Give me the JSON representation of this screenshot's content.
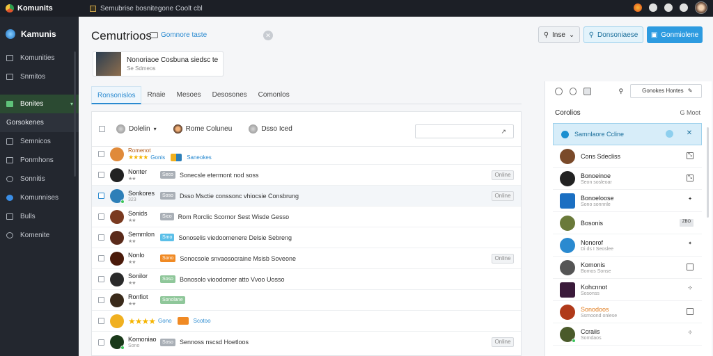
{
  "app": {
    "brand": "Komunits",
    "window_title": "Semubrise bosnitegone Coolt cbl"
  },
  "sidebar": {
    "header": "Kamunis",
    "items": [
      {
        "label": "Komunities"
      },
      {
        "label": "Snmitos"
      },
      {
        "label": "Bonites",
        "active": true
      },
      {
        "label": "Gorsokenes",
        "sub": true
      },
      {
        "label": "Semnicos"
      },
      {
        "label": "Ponmhons"
      },
      {
        "label": "Sonnitis"
      },
      {
        "label": "Komunnises"
      },
      {
        "label": "Bulls"
      },
      {
        "label": "Komenite"
      }
    ]
  },
  "header": {
    "page_title": "Cemutrioos",
    "title_link": "Gomnore taste",
    "filter_button": "Inse",
    "secondary_button": "Donsoniaese",
    "primary_button": "Gonmiolene"
  },
  "profile_card": {
    "title": "Nonoriaoe Cosbuna siedsc te",
    "subtitle": "Se Sdmeos"
  },
  "tabs": [
    "Ronsonislos",
    "Rnaie",
    "Mesoes",
    "Desosones",
    "Comonlos"
  ],
  "table": {
    "header": {
      "col1": "Dolelin",
      "col2": "Rome Coluneu",
      "col3": "Dsso Iced"
    },
    "rows": [
      {
        "name": "Romenot",
        "stars": "★★★★",
        "link": "Gonis",
        "link2": "Saneokes",
        "avatar_color": "#e08a3a"
      },
      {
        "name": "Nonter",
        "sub": "★★",
        "tag": "Seco",
        "desc": "Sonecsle etermont nod soss",
        "status": "Online",
        "avatar_color": "#222222"
      },
      {
        "name": "Sonkores",
        "sub": "323",
        "tag": "Soso",
        "desc": "Dsso Msctie conssonc vhiocsie Consbrung",
        "status": "Online",
        "avatar_color": "#2d7fb8",
        "highlight": true,
        "dot": true
      },
      {
        "name": "Sonids",
        "sub": "★★",
        "tag": "Sico",
        "desc": "Rom Rorclic Scornor Sest Wisde Gesso",
        "avatar_color": "#7a3a20"
      },
      {
        "name": "Semmlon",
        "sub": "★★",
        "tag": "Smo",
        "desc": "Sonoselis viedoomenere Delsie Sebreng",
        "avatar_color": "#5a2a1a"
      },
      {
        "name": "Nonlo",
        "sub": "★★",
        "tag": "Sono",
        "desc": "Sonocsole snvaosocraine Msisb Soveone",
        "status": "Online",
        "avatar_color": "#4a1a0a"
      },
      {
        "name": "Sonilor",
        "sub": "★★",
        "tag": "Soso",
        "desc": "Bonosolo vioodomer atto Vvoo Uosso",
        "avatar_color": "#2a2a2a"
      },
      {
        "name": "Ronfiot",
        "sub": "★★",
        "tag": "Sonolane",
        "avatar_color": "#3a2a1a"
      },
      {
        "name": "",
        "stars": "★★★★",
        "link": "Gono",
        "link2": "Scotoo",
        "avatar_color": "#f0b020"
      },
      {
        "name": "Komoniao",
        "sub": "Sono",
        "tag": "Soso",
        "desc": "Sennoss nscsd Hoetloos",
        "status": "Online",
        "avatar_color": "#1a3a1a",
        "dot": true
      }
    ]
  },
  "right_panel": {
    "search_placeholder": "Gonokes Hontes",
    "heading": "Corolios",
    "count": "G Moot",
    "items": [
      {
        "name": "Samnlaore Ccline",
        "selected": true
      },
      {
        "name": "Cons Sdecliss",
        "avatar_color": "#7a4a2a"
      },
      {
        "name": "Bonoeinoe",
        "sub": "Seon sosleoar",
        "avatar_color": "#222222"
      },
      {
        "name": "Bonoeloose",
        "sub": "Sono sonnnle",
        "avatar_color": "#1b6fc2",
        "square": true
      },
      {
        "name": "Bosonis",
        "badge": "ZBO",
        "avatar_color": "#6a7a3a"
      },
      {
        "name": "Nonorof",
        "sub": "Di ds I Seoslee",
        "avatar_color": "#2a8ad0"
      },
      {
        "name": "Komonis",
        "sub": "Bomos Sonse",
        "avatar_color": "#555555"
      },
      {
        "name": "Kohcnnot",
        "sub": "Sosonss",
        "avatar_color": "#3a1a3a",
        "square": true
      },
      {
        "name": "Sonodoos",
        "sub": "Ssmoond onlese",
        "avatar_color": "#b03a1a",
        "orange": true
      },
      {
        "name": "Ccraiis",
        "sub": "Somdaos",
        "avatar_color": "#4a5a2a",
        "dot": true
      }
    ]
  }
}
